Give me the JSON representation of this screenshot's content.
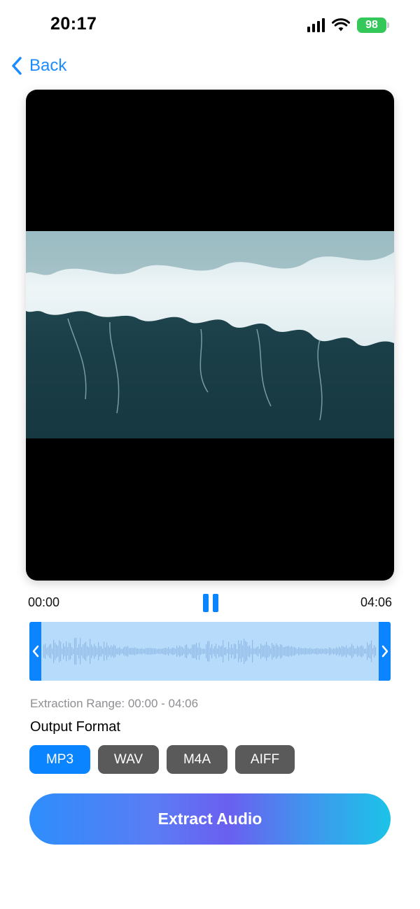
{
  "status_bar": {
    "time": "20:17",
    "battery": "98"
  },
  "nav": {
    "back_label": "Back"
  },
  "player": {
    "start_time": "00:00",
    "end_time": "04:06"
  },
  "extraction": {
    "range_text": "Extraction Range: 00:00 - 04:06"
  },
  "output_format": {
    "title": "Output Format",
    "options": [
      "MP3",
      "WAV",
      "M4A",
      "AIFF"
    ],
    "selected": "MP3"
  },
  "actions": {
    "extract_label": "Extract Audio"
  },
  "colors": {
    "accent": "#0a84ff",
    "battery": "#34c759",
    "selection": "#b7dbfb"
  }
}
